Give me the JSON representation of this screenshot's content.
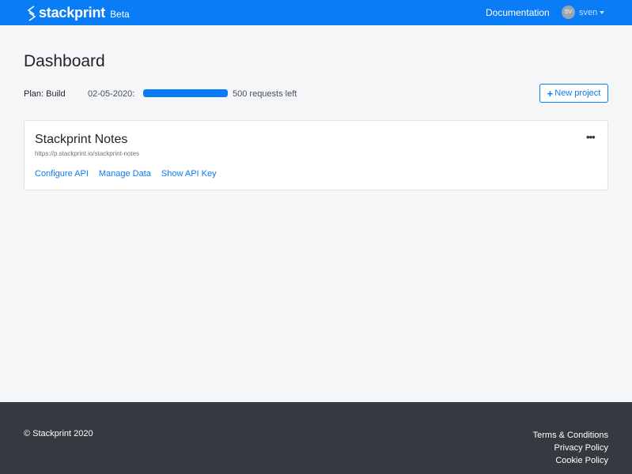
{
  "nav": {
    "brand": "stackprint",
    "badge": "Beta",
    "documentation": "Documentation",
    "user_initials": "SV",
    "username": "sven"
  },
  "main": {
    "title": "Dashboard",
    "plan": "Plan: Build",
    "date": "02-05-2020:",
    "progress_fraction": 1.0,
    "requests_left": "500 requests left",
    "new_project": "New project"
  },
  "project": {
    "name": "Stackprint Notes",
    "url": "https://p.stackprint.io/stackprint-notes",
    "menu": "•••",
    "links": [
      "Configure API",
      "Manage Data",
      "Show API Key"
    ]
  },
  "footer": {
    "copyright": "© Stackprint 2020",
    "links": [
      "Terms & Conditions",
      "Privacy Policy",
      "Cookie Policy"
    ]
  },
  "colors": {
    "primary": "#0a7cf5",
    "footer_bg": "#343a40",
    "page_bg": "#f5f6f8"
  },
  "icons": [
    "stackprint-logo-icon",
    "plus-icon",
    "ellipsis-icon",
    "caret-down-icon"
  ]
}
